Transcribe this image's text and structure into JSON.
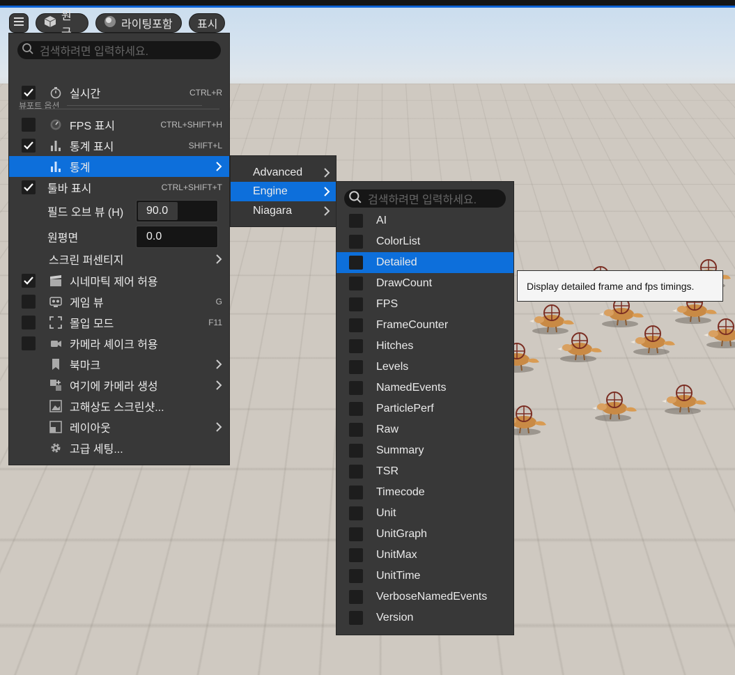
{
  "toolbar": {
    "menu_icon": "hamburger-icon",
    "perspective_label": "원근",
    "lighting_label": "라이팅포함",
    "show_label": "표시"
  },
  "viewport_menu": {
    "search_placeholder": "검색하려면 입력하세요.",
    "section_title": "뷰포트 옵션",
    "realtime": {
      "label": "실시간",
      "shortcut": "CTRL+R",
      "checked": true,
      "icon": "stopwatch-icon"
    },
    "show_fps": {
      "label": "FPS 표시",
      "shortcut": "CTRL+SHIFT+H",
      "checked": false,
      "icon": "gauge-icon"
    },
    "show_stats": {
      "label": "통계 표시",
      "shortcut": "SHIFT+L",
      "checked": true,
      "icon": "bar-chart-icon"
    },
    "stats": {
      "label": "통계",
      "icon": "bar-chart-icon"
    },
    "show_toolbar": {
      "label": "툴바 표시",
      "shortcut": "CTRL+SHIFT+T",
      "checked": true
    },
    "fov": {
      "label": "필드 오브 뷰 (H)",
      "value": "90.0",
      "fill_fraction": 0.5
    },
    "far_plane": {
      "label": "원평면",
      "value": "0.0"
    },
    "screen_percentage": {
      "label": "스크린 퍼센티지"
    },
    "cinematic_control": {
      "label": "시네마틱 제어 허용",
      "checked": true,
      "icon": "clapperboard-icon"
    },
    "game_view": {
      "label": "게임 뷰",
      "shortcut": "G",
      "checked": false,
      "icon": "gamepad-icon"
    },
    "immersive_mode": {
      "label": "몰입 모드",
      "shortcut": "F11",
      "checked": false,
      "icon": "fullscreen-icon"
    },
    "camera_shake": {
      "label": "카메라 셰이크 허용",
      "checked": false,
      "icon": "camera-icon"
    },
    "bookmarks": {
      "label": "북마크",
      "icon": "bookmark-icon"
    },
    "create_camera": {
      "label": "여기에 카메라 생성",
      "icon": "add-camera-icon"
    },
    "high_res_screenshot": {
      "label": "고해상도 스크린샷...",
      "icon": "image-icon"
    },
    "layouts": {
      "label": "레이아웃",
      "icon": "layout-icon"
    },
    "advanced_settings": {
      "label": "고급 세팅...",
      "icon": "gear-icon"
    }
  },
  "stats_submenu": {
    "items": [
      "Advanced",
      "Engine",
      "Niagara"
    ]
  },
  "engine_submenu": {
    "search_placeholder": "검색하려면 입력하세요.",
    "items": [
      "AI",
      "ColorList",
      "Detailed",
      "DrawCount",
      "FPS",
      "FrameCounter",
      "Hitches",
      "Levels",
      "NamedEvents",
      "ParticlePerf",
      "Raw",
      "Summary",
      "TSR",
      "Timecode",
      "Unit",
      "UnitGraph",
      "UnitMax",
      "UnitTime",
      "VerboseNamedEvents",
      "Version"
    ]
  },
  "tooltip": {
    "text": "Display detailed frame and fps timings."
  }
}
